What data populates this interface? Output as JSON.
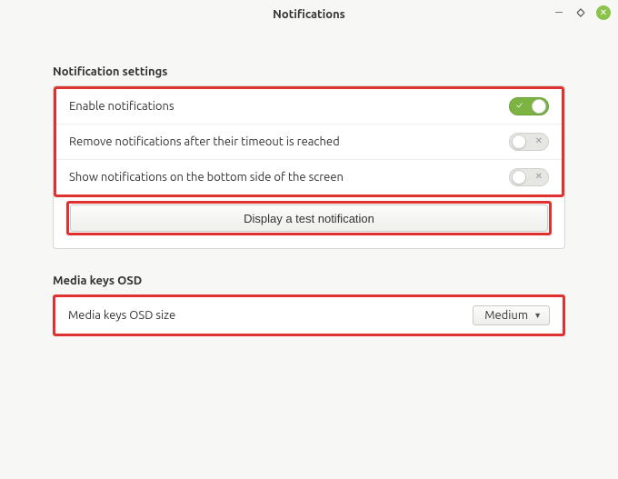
{
  "window": {
    "title": "Notifications"
  },
  "sections": {
    "notification": {
      "title": "Notification settings",
      "rows": {
        "enable": {
          "label": "Enable notifications",
          "on": true
        },
        "remove_timeout": {
          "label": "Remove notifications after their timeout is reached",
          "on": false
        },
        "bottom": {
          "label": "Show notifications on the bottom side of the screen",
          "on": false
        }
      },
      "test_button": "Display a test notification"
    },
    "osd": {
      "title": "Media keys OSD",
      "row": {
        "label": "Media keys OSD size",
        "value": "Medium"
      }
    }
  }
}
